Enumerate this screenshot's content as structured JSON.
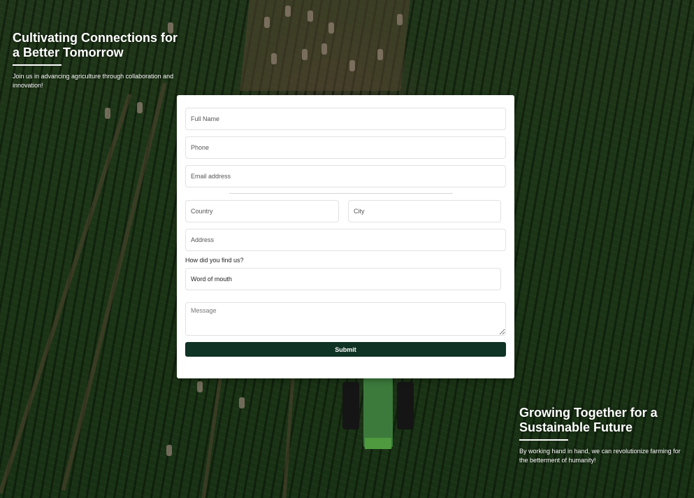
{
  "hero_left": {
    "title": "Cultivating Connections for a Better Tomorrow",
    "text": "Join us in advancing agriculture through collaboration and innovation!"
  },
  "hero_right": {
    "title": "Growing Together for a Sustainable Future",
    "text": "By working hand in hand, we can revolutionize farming for the betterment of humanity!"
  },
  "form": {
    "full_name_placeholder": "Full Name",
    "phone_placeholder": "Phone",
    "email_placeholder": "Email address",
    "country_placeholder": "Country",
    "city_placeholder": "City",
    "address_placeholder": "Address",
    "source_label": "How did you find us?",
    "source_selected": "Word of mouth",
    "message_placeholder": "Message",
    "submit_label": "Submit"
  },
  "colors": {
    "submit_button": "#0f3325",
    "card": "#ffffff",
    "background": "#1d3418"
  }
}
